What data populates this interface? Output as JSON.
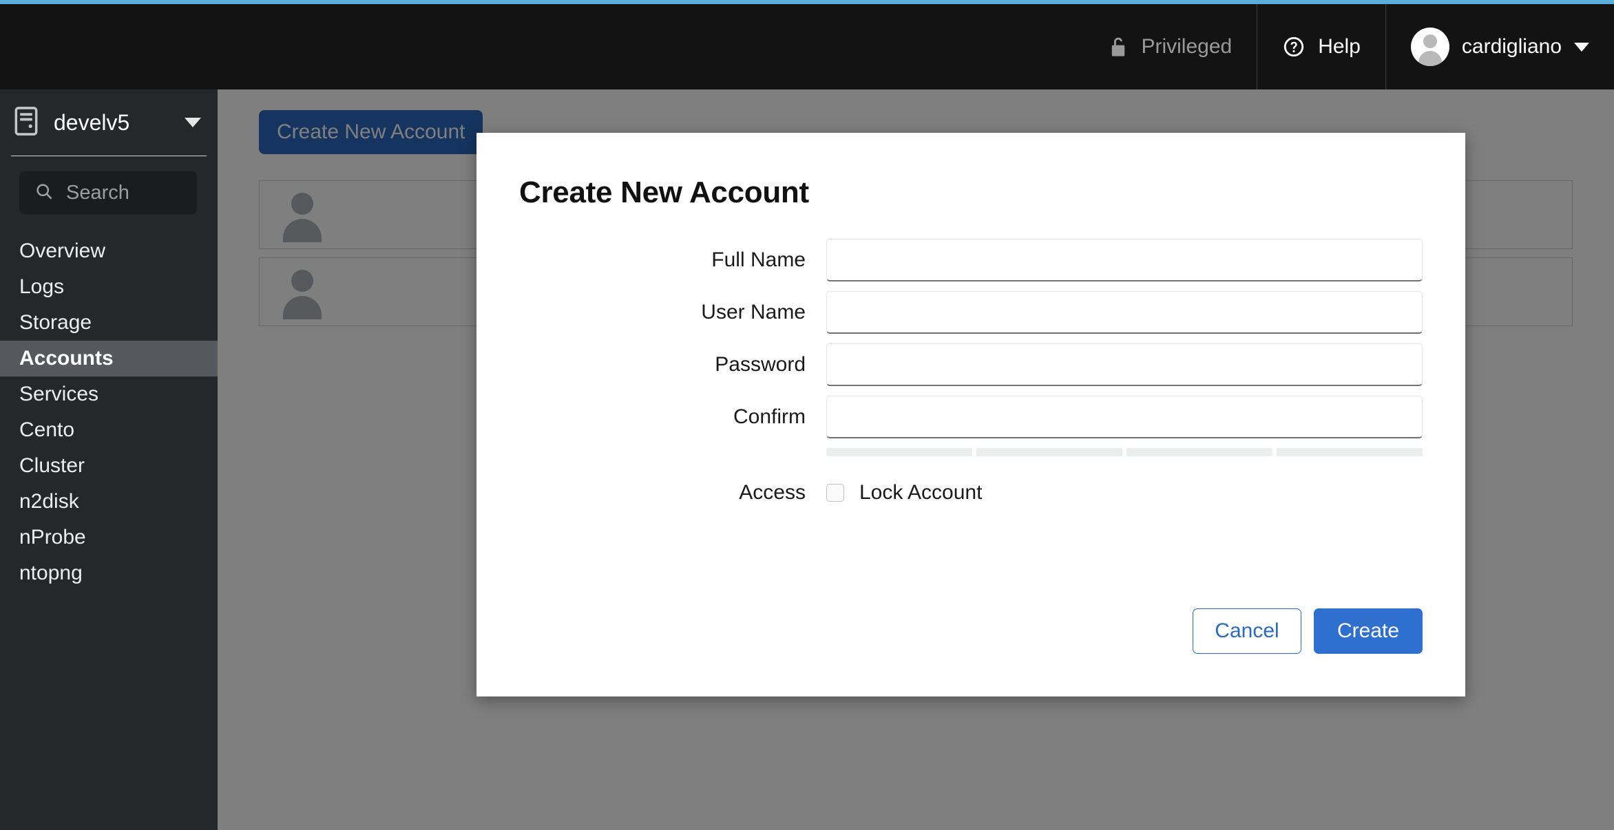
{
  "theme": {
    "accent_bar_color": "#5badde",
    "header_bg": "#131313",
    "sidebar_bg": "#25272b",
    "sidebar_active_bg": "#55585d",
    "primary_button_color": "#2f6fcd",
    "link_color": "#2a6ac0"
  },
  "header": {
    "privileged_label": "Privileged",
    "privileged_icon": "unlock-icon",
    "help_label": "Help",
    "help_icon": "question-circle-icon",
    "user_name": "cardigliano",
    "user_icon": "avatar-icon",
    "user_chevron": "chevron-down-icon"
  },
  "sidebar": {
    "host_name": "develv5",
    "host_icon": "server-icon",
    "host_chevron": "chevron-down-icon",
    "search": {
      "icon": "search-icon",
      "placeholder": "Search",
      "value": ""
    },
    "items": [
      {
        "label": "Overview",
        "active": false
      },
      {
        "label": "Logs",
        "active": false
      },
      {
        "label": "Storage",
        "active": false
      },
      {
        "label": "Accounts",
        "active": true
      },
      {
        "label": "Services",
        "active": false
      },
      {
        "label": "Cento",
        "active": false
      },
      {
        "label": "Cluster",
        "active": false
      },
      {
        "label": "n2disk",
        "active": false
      },
      {
        "label": "nProbe",
        "active": false
      },
      {
        "label": "ntopng",
        "active": false
      }
    ]
  },
  "main": {
    "create_button_label": "Create New Account",
    "account_cards": [
      {
        "avatar_icon": "avatar-placeholder-icon"
      },
      {
        "avatar_icon": "avatar-placeholder-icon"
      }
    ]
  },
  "modal": {
    "title": "Create New Account",
    "fields": [
      {
        "label": "Full Name",
        "value": "",
        "placeholder": "",
        "type": "text"
      },
      {
        "label": "User Name",
        "value": "",
        "placeholder": "",
        "type": "text"
      },
      {
        "label": "Password",
        "value": "",
        "placeholder": "",
        "type": "password"
      },
      {
        "label": "Confirm",
        "value": "",
        "placeholder": "",
        "type": "password"
      }
    ],
    "password_strength": {
      "segments": 4,
      "filled": 0,
      "empty_color": "#eceded"
    },
    "access": {
      "label": "Access",
      "checkbox_label": "Lock Account",
      "checked": false
    },
    "cancel_label": "Cancel",
    "create_label": "Create"
  }
}
